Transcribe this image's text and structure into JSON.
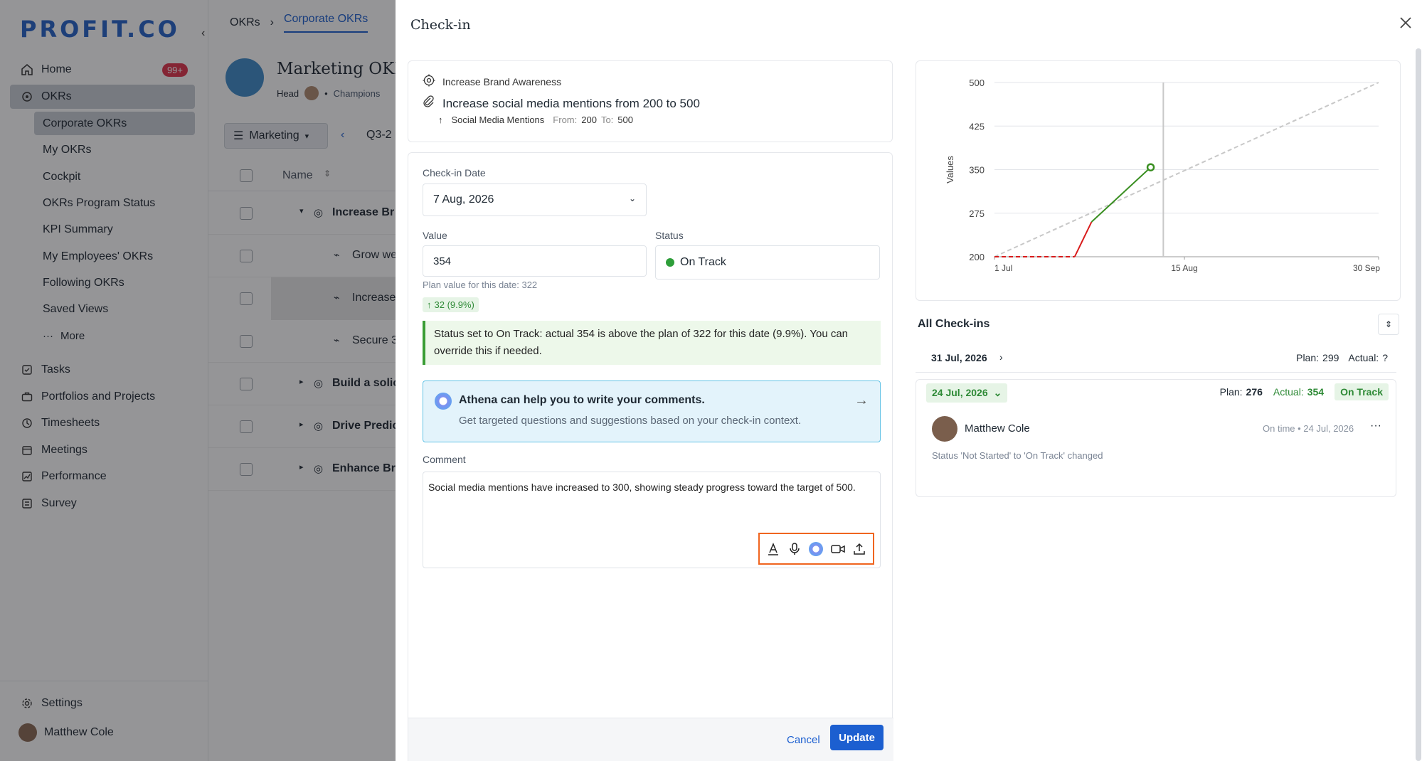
{
  "sidebar": {
    "logo": "PROFIT.CO",
    "home": "Home",
    "home_badge": "99+",
    "okrs": "OKRs",
    "sub_items": [
      "Corporate OKRs",
      "My OKRs",
      "Cockpit",
      "OKRs Program Status",
      "KPI Summary",
      "My Employees' OKRs",
      "Following OKRs",
      "Saved Views",
      "More"
    ],
    "items": [
      "Tasks",
      "Portfolios and Projects",
      "Timesheets",
      "Meetings",
      "Performance",
      "Survey"
    ],
    "settings": "Settings",
    "user": "Matthew Cole"
  },
  "main": {
    "breadcrumb_root": "OKRs",
    "breadcrumb_tab": "Corporate OKRs",
    "title": "Marketing OKRs",
    "head_label": "Head",
    "champions": "Champions",
    "team_button": "Marketing",
    "period": "Q3-2",
    "column_name": "Name",
    "rows": [
      "Increase Br",
      "Grow we",
      "Increase",
      "Secure 3",
      "Build a solic",
      "Drive Predic",
      "Enhance Br"
    ]
  },
  "checkin": {
    "title": "Check-in",
    "objective": "Increase Brand Awareness",
    "key_result": "Increase social media mentions from 200 to 500",
    "metric": "Social Media Mentions",
    "from_label": "From:",
    "from_value": "200",
    "to_label": "To:",
    "to_value": "500",
    "date_label": "Check-in Date",
    "date_value": "7 Aug, 2026",
    "value_label": "Value",
    "value": "354",
    "status_label": "Status",
    "status_value": "On Track",
    "plan_hint": "Plan value for this date: 322",
    "delta": "32 (9.9%)",
    "status_message": "Status set to On Track: actual 354 is above the plan of 322 for this date (9.9%). You can override this if needed.",
    "athena_title": "Athena can help you to write your comments.",
    "athena_sub": "Get targeted questions and suggestions based on your check-in context.",
    "comment_label": "Comment",
    "comment": "Social media mentions have increased to 300, showing steady progress toward the target of 500.",
    "cancel": "Cancel",
    "update": "Update"
  },
  "history": {
    "title": "All Check-ins",
    "entries": [
      {
        "date": "31 Jul, 2026",
        "plan_label": "Plan:",
        "plan": "299",
        "actual_label": "Actual:",
        "actual": "?"
      },
      {
        "date": "24 Jul, 2026",
        "plan_label": "Plan:",
        "plan": "276",
        "actual_label": "Actual:",
        "actual": "354",
        "status": "On Track",
        "user": "Matthew Cole",
        "meta": "On time • 24 Jul, 2026",
        "note": "Status 'Not Started' to 'On Track' changed"
      }
    ]
  },
  "chart_data": {
    "type": "line",
    "ylabel": "Values",
    "yticks": [
      200,
      275,
      350,
      425,
      500
    ],
    "xticks": [
      "1 Jul",
      "15 Aug",
      "30 Sep"
    ],
    "ylim": [
      200,
      500
    ],
    "xlim": [
      "2026-07-01",
      "2026-09-30"
    ],
    "series": [
      {
        "values": [
          [
            "2026-07-01",
            200
          ],
          [
            "2026-09-30",
            500
          ]
        ],
        "style": "dashed",
        "color": "#c8c8c8"
      },
      {
        "values": [
          [
            "2026-07-01",
            200
          ],
          [
            "2026-07-20",
            200
          ]
        ],
        "style": "dashed",
        "color": "#d81b1b"
      },
      {
        "values": [
          [
            "2026-07-20",
            200
          ],
          [
            "2026-07-24",
            260
          ]
        ],
        "style": "solid",
        "color": "#d81b1b"
      },
      {
        "values": [
          [
            "2026-07-24",
            260
          ],
          [
            "2026-08-07",
            354
          ]
        ],
        "style": "solid",
        "color": "#3a8f22"
      }
    ],
    "today_marker": "2026-08-10"
  },
  "colors": {
    "accent": "#1c5fd0",
    "success": "#2e9e3a",
    "danger": "#d81b1b",
    "highlight": "#f0651f"
  }
}
